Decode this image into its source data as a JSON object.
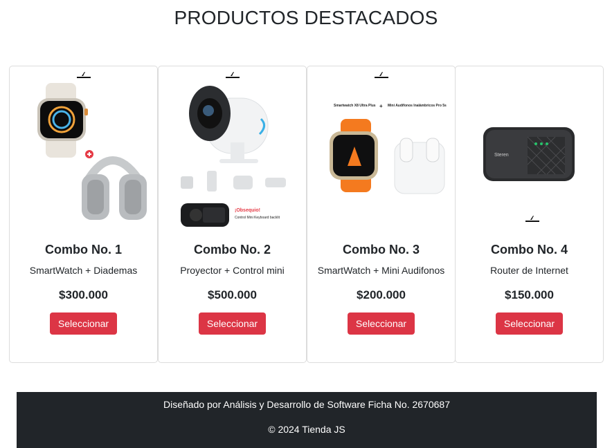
{
  "page": {
    "title": "PRODUCTOS DESTACADOS"
  },
  "products": [
    {
      "name": "Combo No. 1",
      "description": "SmartWatch + Diademas",
      "price": "$300.000",
      "button": "Seleccionar"
    },
    {
      "name": "Combo No. 2",
      "description": "Proyector + Control mini",
      "price": "$500.000",
      "button": "Seleccionar",
      "image_text": {
        "promo": "¡Obsequio!",
        "promo_detail": "Control Mini Keyboard backlit"
      }
    },
    {
      "name": "Combo No. 3",
      "description": "SmartWatch + Mini Audifonos",
      "price": "$200.000",
      "button": "Seleccionar",
      "image_text": {
        "left": "Smartwatch X8 Ultra Plus",
        "plus": "+",
        "right": "Mini Audífonos Inalámbricos Pro 5s"
      }
    },
    {
      "name": "Combo No. 4",
      "description": "Router de Internet",
      "price": "$150.000",
      "button": "Seleccionar",
      "image_text": {
        "brand": "Steren"
      }
    }
  ],
  "footer": {
    "credits": "Diseñado por Análisis y Desarrollo de Software Ficha No. 2670687",
    "copyright": "© 2024 Tienda JS"
  },
  "colors": {
    "accent": "#dc3545",
    "footer_bg": "#212529",
    "border": "#dcdcdc"
  }
}
